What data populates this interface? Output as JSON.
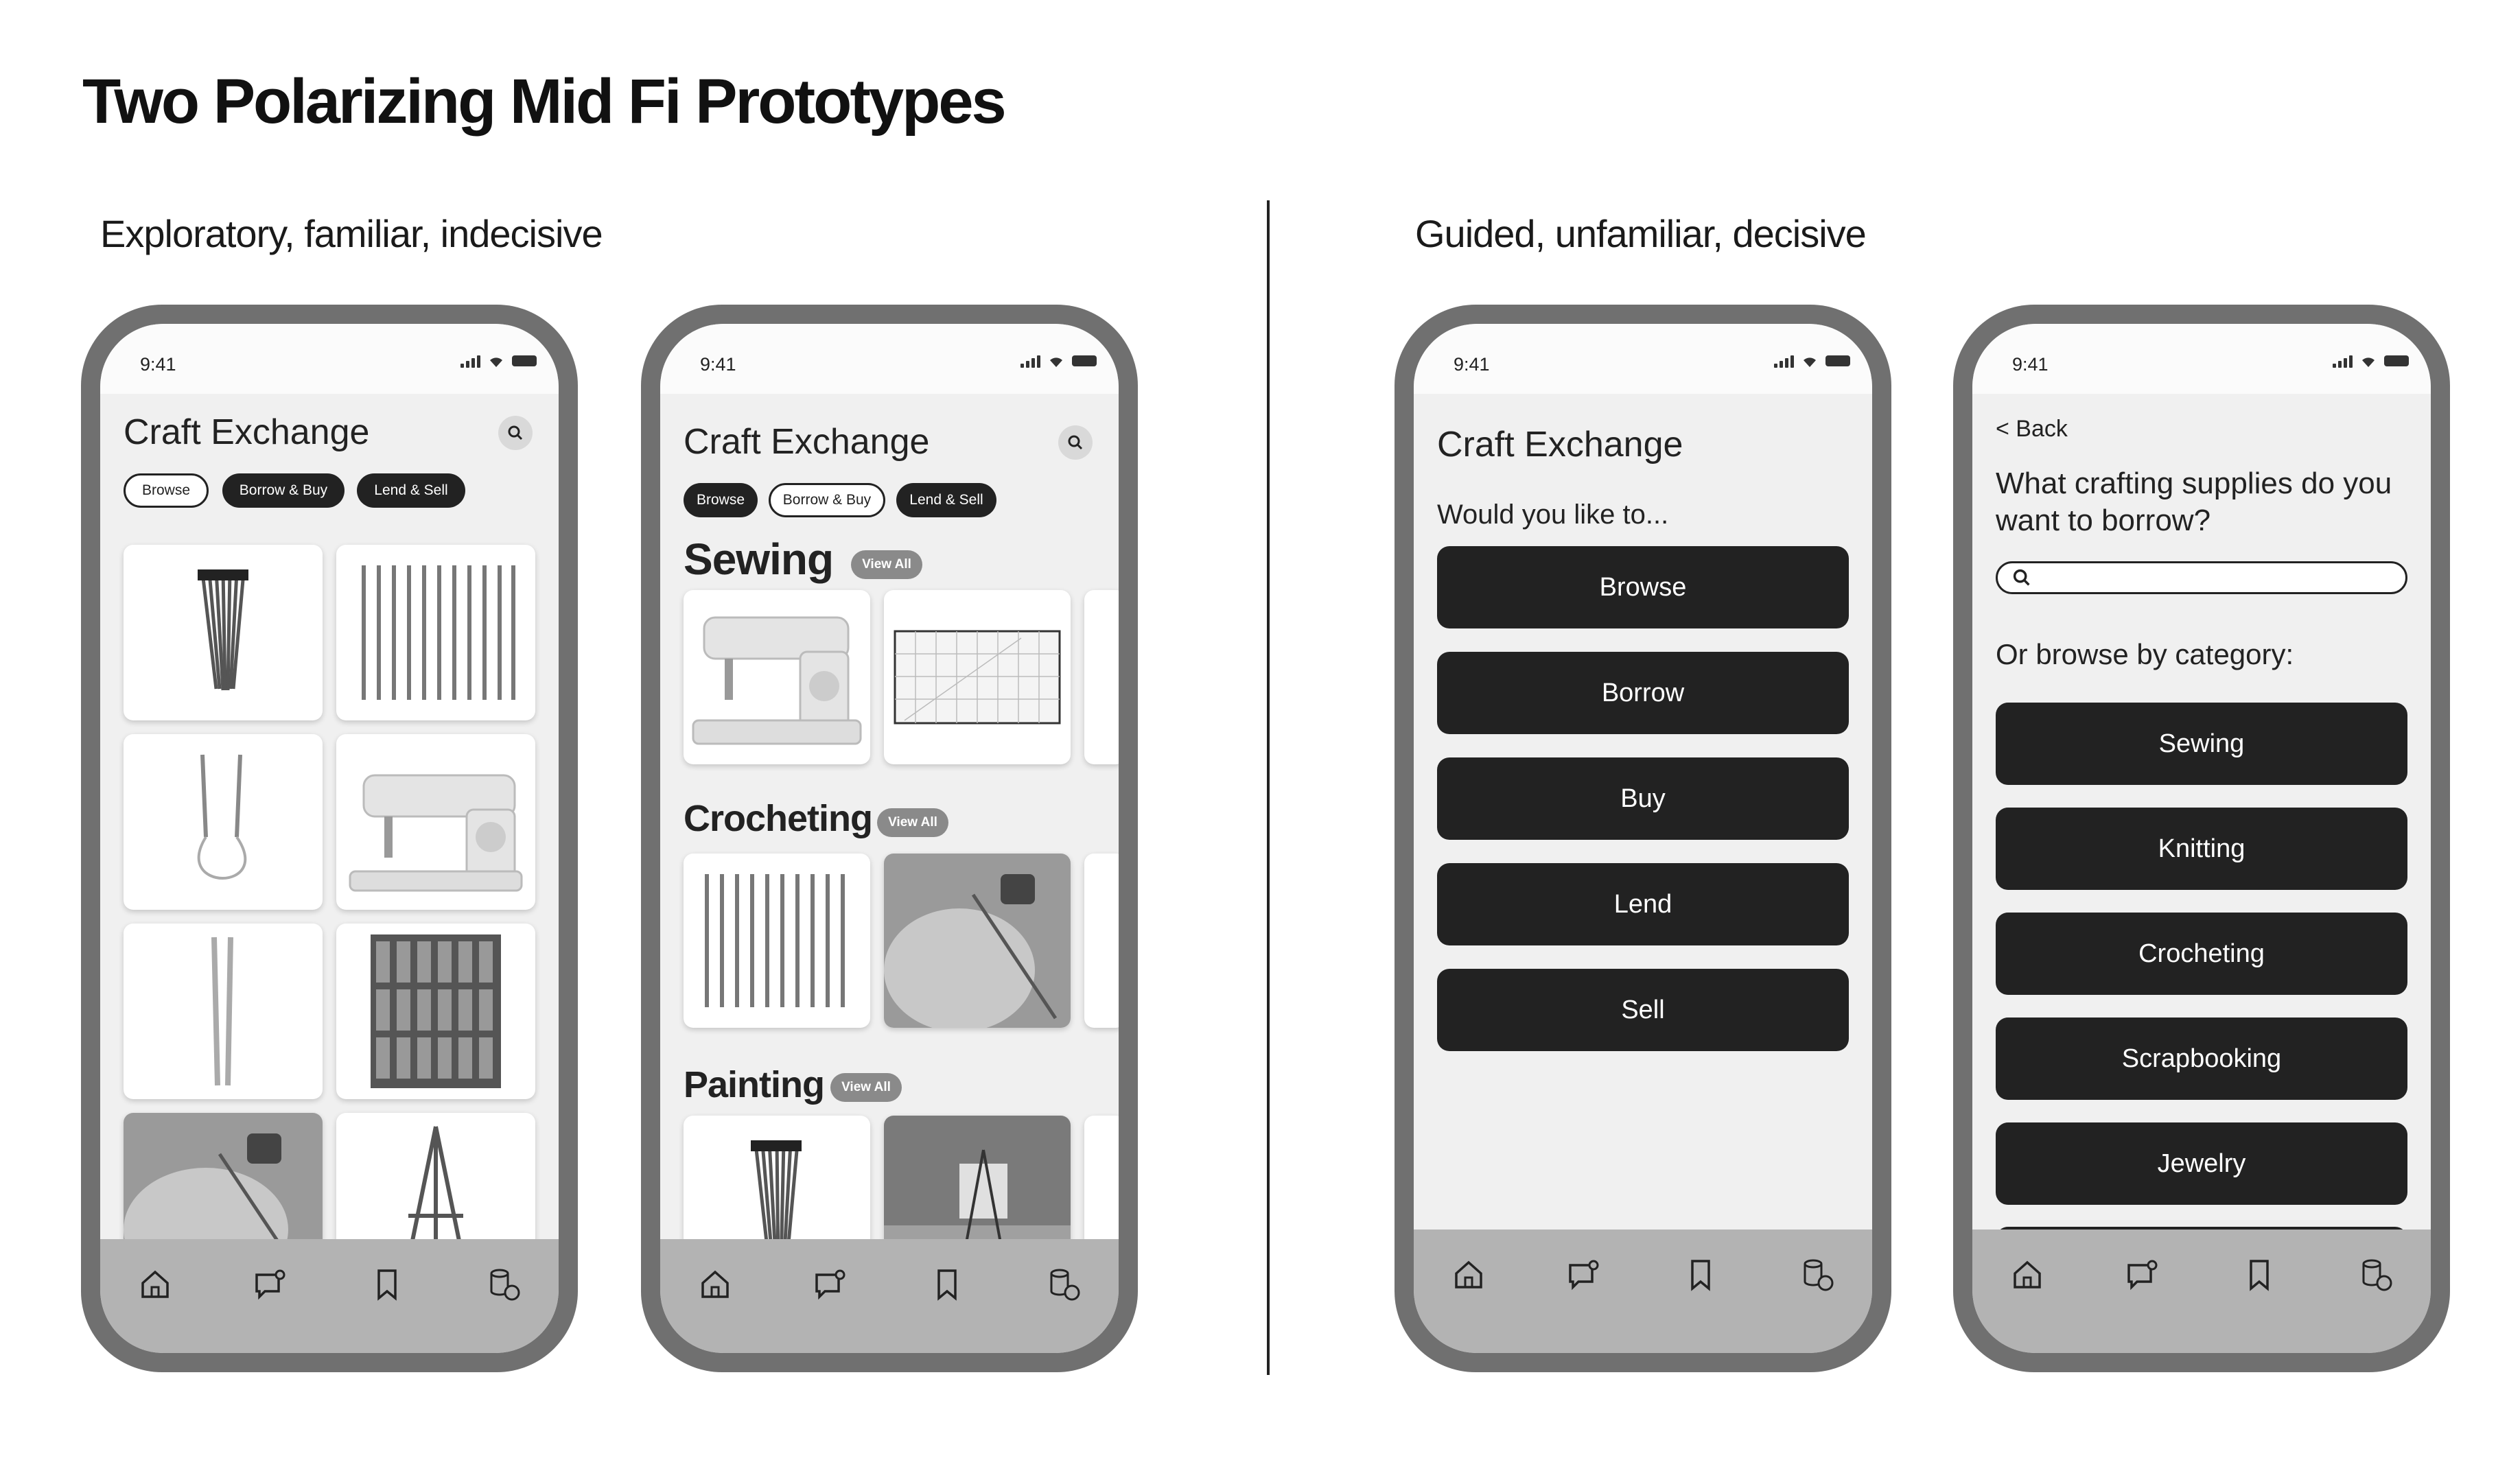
{
  "title": "Two Polarizing Mid Fi Prototypes",
  "left_subtitle": "Exploratory, familiar, indecisive",
  "right_subtitle": "Guided, unfamiliar, decisive",
  "status": {
    "time": "9:41"
  },
  "app_name": "Craft Exchange",
  "tabs": {
    "browse": "Browse",
    "borrow_buy": "Borrow & Buy",
    "lend_sell": "Lend & Sell"
  },
  "view_all": "View All",
  "sections": {
    "sewing": "Sewing",
    "crocheting": "Crocheting",
    "painting": "Painting"
  },
  "guided": {
    "prompt": "Would you like to...",
    "options": [
      "Browse",
      "Borrow",
      "Buy",
      "Lend",
      "Sell"
    ]
  },
  "category": {
    "back": "< Back",
    "question": "What crafting supplies do you want to borrow?",
    "browse_label": "Or browse by category:",
    "options": [
      "Sewing",
      "Knitting",
      "Crocheting",
      "Scrapbooking",
      "Jewelry"
    ]
  },
  "nav_icons": [
    "home-icon",
    "chat-icon",
    "bookmark-icon",
    "coins-icon"
  ],
  "colors": {
    "frame": "#707070",
    "screen": "#f0f0f0",
    "button": "#222222",
    "tabbar": "#b3b3b3"
  }
}
